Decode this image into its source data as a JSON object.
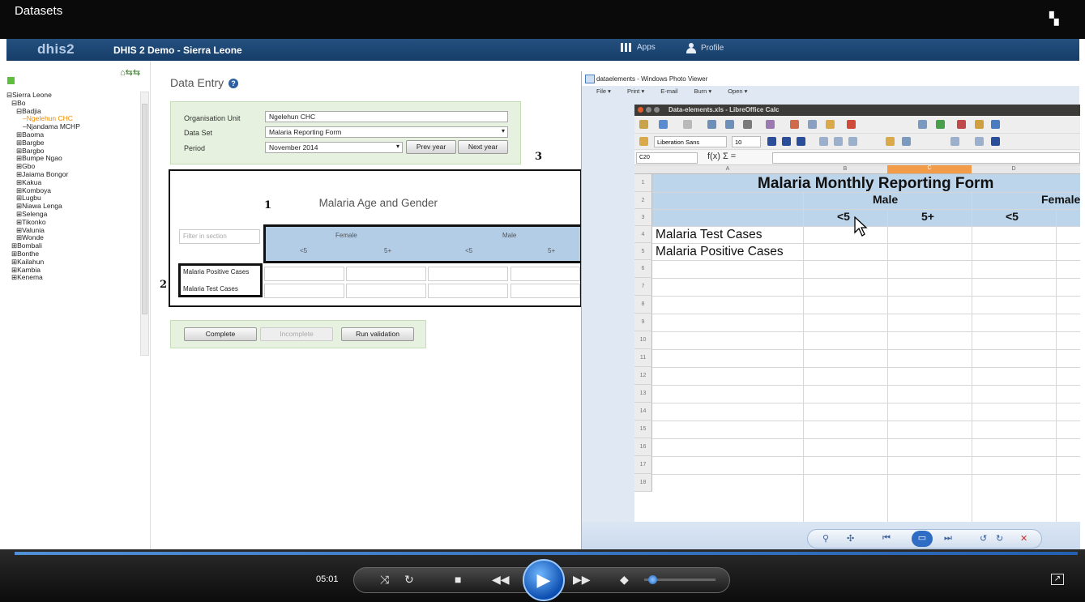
{
  "window": {
    "title": "Datasets"
  },
  "app": {
    "logo": "dhis2",
    "title": "DHIS 2 Demo - Sierra Leone",
    "apps": "Apps",
    "profile": "Profile"
  },
  "tree": {
    "items": [
      "Sierra Leone",
      "Bo",
      "Badjia",
      "Ngelehun CHC",
      "Njandama MCHP",
      "Baoma",
      "Bargbe",
      "Bargbo",
      "Bumpe Ngao",
      "Gbo",
      "Jaiama Bongor",
      "Kakua",
      "Komboya",
      "Lugbu",
      "Niawa Lenga",
      "Selenga",
      "Tikonko",
      "Valunia",
      "Wonde",
      "Bombali",
      "Bonthe",
      "Kailahun",
      "Kambia",
      "Kenema"
    ]
  },
  "dataentry": {
    "title": "Data Entry",
    "org_label": "Organisation Unit",
    "org_value": "Ngelehun CHC",
    "dataset_label": "Data Set",
    "dataset_value": "Malaria Reporting Form",
    "period_label": "Period",
    "period_value": "November 2014",
    "prev_year": "Prev year",
    "next_year": "Next year",
    "section_title": "Malaria Age and Gender",
    "filter_placeholder": "Filter in section",
    "col_groups": [
      "Female",
      "Male"
    ],
    "col_sub": [
      "<5",
      "5+",
      "<5",
      "5+"
    ],
    "rows": [
      "Malaria Positive Cases",
      "Malaria Test Cases"
    ],
    "complete": "Complete",
    "incomplete": "Incomplete",
    "run_validation": "Run validation",
    "annotations": [
      "1",
      "2",
      "3"
    ]
  },
  "viewer": {
    "title": "dataelements - Windows Photo Viewer",
    "menu": [
      "File ▾",
      "Print ▾",
      "E-mail",
      "Burn ▾",
      "Open ▾"
    ],
    "calc_title": "Data-elements.xls - LibreOffice Calc",
    "font_name": "Liberation Sans",
    "font_size": "10",
    "cell_ref": "C20",
    "fx": "f(x) Σ =",
    "columns": [
      "A",
      "B",
      "C",
      "D"
    ],
    "rows": [
      "1",
      "2",
      "3",
      "4",
      "5",
      "6",
      "7",
      "8",
      "9",
      "10",
      "11",
      "12",
      "13",
      "14",
      "15",
      "16",
      "17",
      "18"
    ],
    "sheet_title": "Malaria Monthly Reporting Form",
    "male": "Male",
    "female": "Female",
    "sub": [
      "<5",
      "5+",
      "<5"
    ],
    "r4": "Malaria Test Cases",
    "r5": "Malaria Positive Cases"
  },
  "player": {
    "time": "05:01"
  }
}
